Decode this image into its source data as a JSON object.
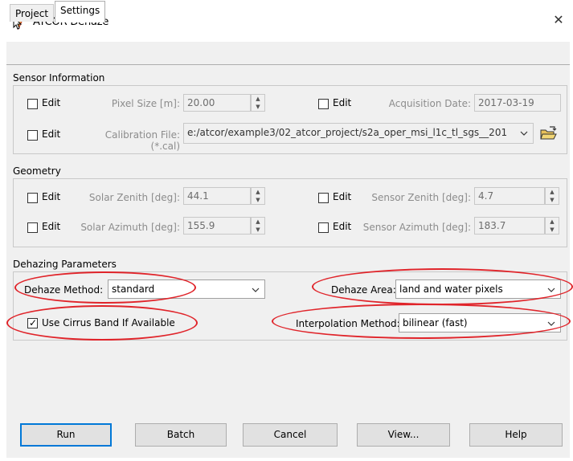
{
  "window": {
    "title": "ATCOR Dehaze",
    "close_label": "✕"
  },
  "tabs": [
    {
      "label": "Project"
    },
    {
      "label": "Settings"
    }
  ],
  "sensor": {
    "group_title": "Sensor Information",
    "edit_label": "Edit",
    "pixel_size_label": "Pixel Size [m]:",
    "pixel_size_value": "20.00",
    "acq_date_label": "Acquisition Date:",
    "acq_date_value": "2017-03-19",
    "cal_file_label": "Calibration File: (*.cal)",
    "cal_file_value": "e:/atcor/example3/02_atcor_project/s2a_oper_msi_l1c_tl_sgs__201"
  },
  "geometry": {
    "group_title": "Geometry",
    "edit_label": "Edit",
    "solar_zenith_label": "Solar Zenith [deg]:",
    "solar_zenith_value": "44.1",
    "sensor_zenith_label": "Sensor Zenith [deg]:",
    "sensor_zenith_value": "4.7",
    "solar_azimuth_label": "Solar Azimuth [deg]:",
    "solar_azimuth_value": "155.9",
    "sensor_azimuth_label": "Sensor Azimuth [deg]:",
    "sensor_azimuth_value": "183.7"
  },
  "dehaze": {
    "group_title": "Dehazing Parameters",
    "method_label": "Dehaze Method:",
    "method_value": "standard",
    "area_label": "Dehaze Area:",
    "area_value": "land and water pixels",
    "cirrus_label": "Use Cirrus Band If Available",
    "cirrus_checked": true,
    "interp_label": "Interpolation Method:",
    "interp_value": "bilinear (fast)"
  },
  "buttons": {
    "run": "Run",
    "batch": "Batch",
    "cancel": "Cancel",
    "view": "View...",
    "help": "Help"
  },
  "colors": {
    "highlight_ellipse": "#e0242a",
    "default_button_border": "#0078d7"
  }
}
